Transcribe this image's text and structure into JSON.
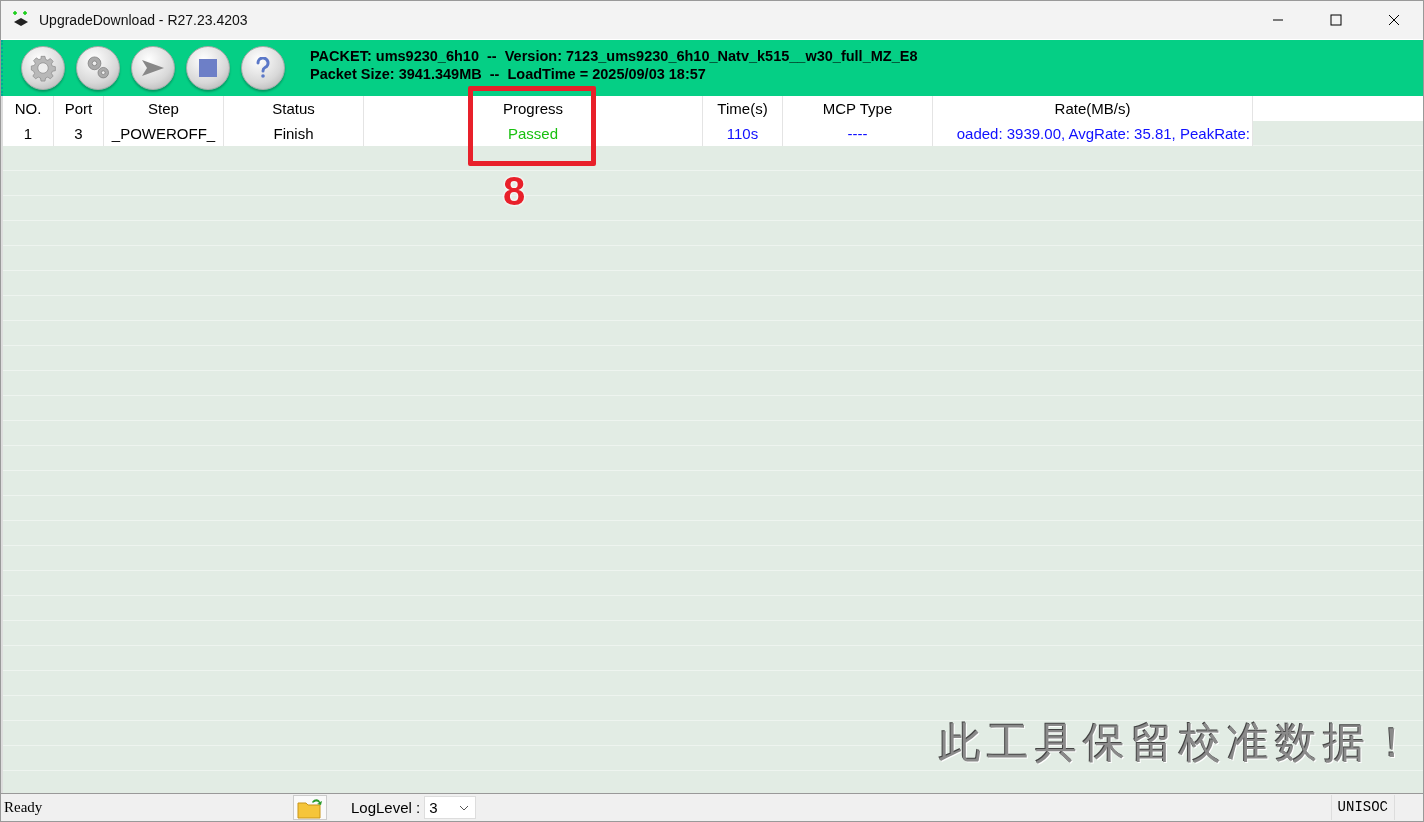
{
  "window": {
    "title": "UpgradeDownload - R27.23.4203"
  },
  "packet_info": [
    "PACKET: ums9230_6h10  --  Version: 7123_ums9230_6h10_Natv_k515__w30_full_MZ_E8",
    "Packet Size: 3941.349MB  --  LoadTime = 2025/09/03 18:57"
  ],
  "table": {
    "columns": [
      "NO.",
      "Port",
      "Step",
      "Status",
      "Progress",
      "Time(s)",
      "MCP Type",
      "Rate(MB/s)"
    ],
    "rows": [
      {
        "cells": [
          {
            "text": "1",
            "kind": "plain"
          },
          {
            "text": "3",
            "kind": "plain"
          },
          {
            "text": "_POWEROFF_",
            "kind": "plain"
          },
          {
            "text": "Finish",
            "kind": "plain"
          },
          {
            "text": "Passed",
            "kind": "passed"
          },
          {
            "text": "110s",
            "kind": "info"
          },
          {
            "text": "----",
            "kind": "info"
          },
          {
            "text": "oaded: 3939.00, AvgRate: 35.81, PeakRate:",
            "kind": "info"
          }
        ]
      }
    ]
  },
  "notice": "此工具保留校准数据！",
  "annotation": {
    "label": "8"
  },
  "status_bar": {
    "status": "Ready",
    "log_level_label": "LogLevel :",
    "log_level": "3",
    "vendor": "UNISOC"
  }
}
